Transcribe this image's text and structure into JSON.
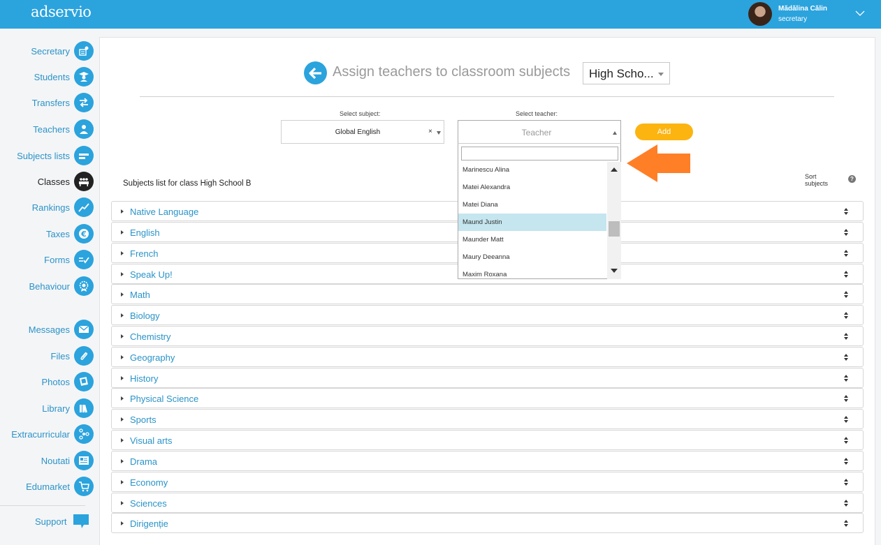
{
  "header": {
    "logo": "adservio",
    "user_name": "Mădălina Călin",
    "user_role": "secretary"
  },
  "sidebar": {
    "items": [
      {
        "label": "Secretary",
        "icon": "secretary-icon"
      },
      {
        "label": "Students",
        "icon": "student-icon"
      },
      {
        "label": "Transfers",
        "icon": "transfer-arrows-icon"
      },
      {
        "label": "Teachers",
        "icon": "teacher-icon"
      },
      {
        "label": "Subjects lists",
        "icon": "subjects-list-icon"
      },
      {
        "label": "Classes",
        "icon": "classes-icon"
      },
      {
        "label": "Rankings",
        "icon": "rankings-chart-icon"
      },
      {
        "label": "Taxes",
        "icon": "euro-icon"
      },
      {
        "label": "Forms",
        "icon": "forms-check-icon"
      },
      {
        "label": "Behaviour",
        "icon": "behaviour-badge-icon"
      },
      {
        "label": "Messages",
        "icon": "envelope-icon"
      },
      {
        "label": "Files",
        "icon": "paperclip-icon"
      },
      {
        "label": "Photos",
        "icon": "photos-icon"
      },
      {
        "label": "Library",
        "icon": "books-icon"
      },
      {
        "label": "Extracurricular",
        "icon": "extracurricular-icon"
      },
      {
        "label": "Noutati",
        "icon": "news-icon"
      },
      {
        "label": "Edumarket",
        "icon": "cart-icon"
      }
    ],
    "active_index": 5,
    "support_label": "Support"
  },
  "page": {
    "title": "Assign teachers to classroom subjects",
    "class_select": "High Scho..."
  },
  "form": {
    "subject_label": "Select subject:",
    "subject_value": "Global English",
    "subject_clear": "×",
    "teacher_label": "Select teacher:",
    "teacher_placeholder": "Teacher",
    "search_value": "",
    "add_label": "Add"
  },
  "teacher_dropdown": {
    "options": [
      "Marinescu Alina",
      "Matei Alexandra",
      "Matei Diana",
      "Maund Justin",
      "Maunder Matt",
      "Maury Deeanna",
      "Maxim Roxana"
    ],
    "highlighted_index": 3
  },
  "subjects_list": {
    "title": "Subjects list for class High School B",
    "sort_label_line1": "Sort",
    "sort_label_line2": "subjects",
    "help": "?",
    "rows": [
      "Native Language",
      "English",
      "French",
      "Speak Up!",
      "Math",
      "Biology",
      "Chemistry",
      "Geography",
      "History",
      "Physical Science",
      "Sports",
      "Visual arts",
      "Drama",
      "Economy",
      "Sciences",
      "Dirigenție"
    ]
  },
  "colors": {
    "brand_blue": "#2ba3dd",
    "add_button": "#fcb410",
    "callout_arrow": "#ff7f27",
    "highlight": "#c5e5ef"
  }
}
